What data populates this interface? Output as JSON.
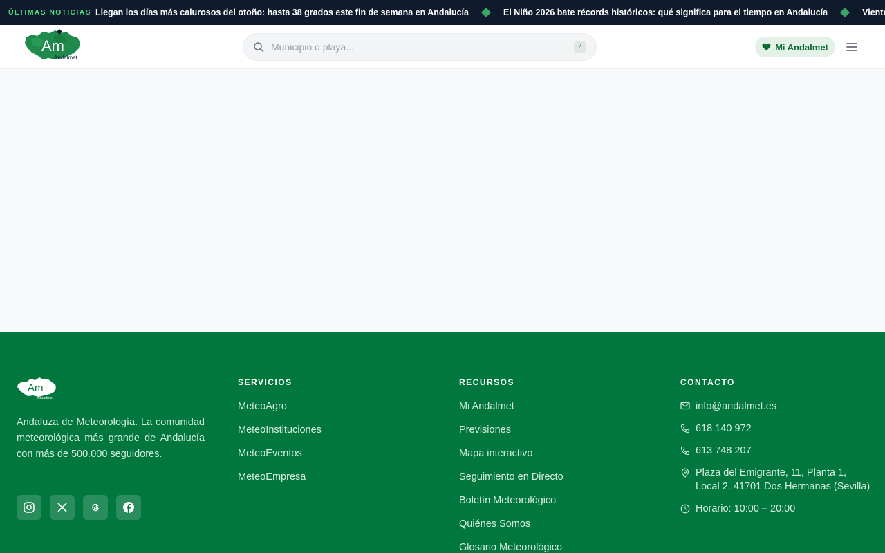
{
  "ticker": {
    "label": "ÚLTIMAS NOTICIAS",
    "items": [
      "Llegan los días más calurosos del otoño: hasta 38 grados este fin de semana en Andalucía",
      "El Niño 2026 bate récords históricos: qué significa para el tiempo en Andalucía",
      "Viento de levante en el Estrecho"
    ]
  },
  "header": {
    "logo_text": "Am",
    "logo_sub": "Andalmet",
    "search": {
      "placeholder": "Municipio o playa...",
      "shortcut": "/"
    },
    "mi_button": "Mi Andalmet"
  },
  "footer": {
    "logo_text": "Am",
    "logo_sub": "Andalmet",
    "description": "Andaluza de Meteorología. La comunidad meteorológica más grande de Andalucía con más de 500.000 seguidores.",
    "socials": [
      "instagram-icon",
      "x-icon",
      "threads-icon",
      "facebook-icon"
    ],
    "servicios": {
      "heading": "SERVICIOS",
      "items": [
        "MeteoAgro",
        "MeteoInstituciones",
        "MeteoEventos",
        "MeteoEmpresa"
      ]
    },
    "recursos": {
      "heading": "RECURSOS",
      "items": [
        "Mi Andalmet",
        "Previsiones",
        "Mapa interactivo",
        "Seguimiento en Directo",
        "Boletín Meteorológico",
        "Quiénes Somos",
        "Glosario Meteorológico"
      ]
    },
    "contacto": {
      "heading": "CONTACTO",
      "email": "info@andalmet.es",
      "phone1": "618 140 972",
      "phone2": "613 748 207",
      "address_line1": "Plaza del Emigrante, 11, Planta 1,",
      "address_line2": "Local 2. 41701 Dos Hermanas (Sevilla)",
      "hours": "Horario: 10:00 – 20:00"
    }
  },
  "colors": {
    "brand_green": "#00783d",
    "ticker_bg": "#0f1a2c",
    "ticker_label": "#4ade80"
  }
}
